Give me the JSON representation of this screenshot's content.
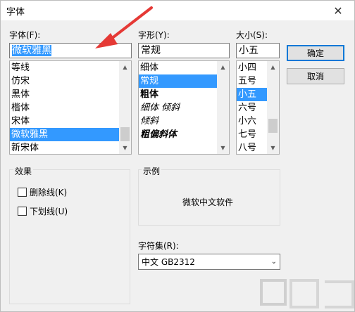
{
  "window": {
    "title": "字体"
  },
  "font": {
    "label": "字体(F):",
    "value": "微软雅黑",
    "items": [
      "等线",
      "仿宋",
      "黑体",
      "楷体",
      "宋体",
      "微软雅黑",
      "新宋体"
    ],
    "selected": "微软雅黑"
  },
  "style": {
    "label": "字形(Y):",
    "value": "常规",
    "items": [
      "细体",
      "常规",
      "粗体",
      "细体 倾斜",
      "倾斜",
      "粗偏斜体"
    ],
    "selected": "常规"
  },
  "size": {
    "label": "大小(S):",
    "value": "小五",
    "items": [
      "小四",
      "五号",
      "小五",
      "六号",
      "小六",
      "七号",
      "八号"
    ],
    "selected": "小五"
  },
  "buttons": {
    "ok": "确定",
    "cancel": "取消"
  },
  "effects": {
    "title": "效果",
    "strikeout": "删除线(K)",
    "underline": "下划线(U)"
  },
  "sample": {
    "title": "示例",
    "text": "微软中文软件"
  },
  "charset": {
    "label": "字符集(R):",
    "value": "中文 GB2312"
  },
  "icons": {
    "close": "close-icon",
    "scroll_up": "chevron-up-icon",
    "scroll_down": "chevron-down-icon",
    "dropdown": "chevron-down-icon",
    "annotation": "red-arrow-icon"
  },
  "colors": {
    "selection": "#3399ff",
    "default_button_border": "#0078d7",
    "annotation": "#e53935"
  }
}
